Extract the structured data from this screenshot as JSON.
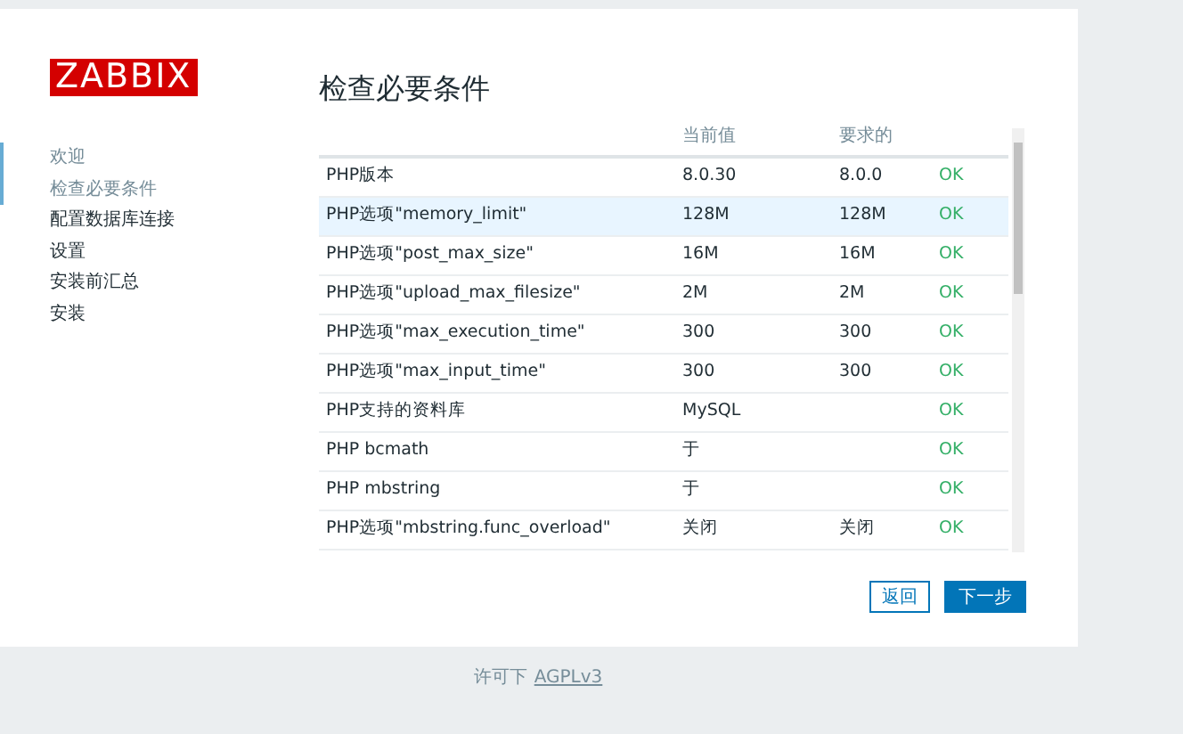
{
  "logo": "ZABBIX",
  "steps": [
    {
      "label": "欢迎",
      "completed": true
    },
    {
      "label": "检查必要条件",
      "completed": true
    },
    {
      "label": "配置数据库连接",
      "completed": false
    },
    {
      "label": "设置",
      "completed": false
    },
    {
      "label": "安装前汇总",
      "completed": false
    },
    {
      "label": "安装",
      "completed": false
    }
  ],
  "title": "检查必要条件",
  "table": {
    "columns": [
      "当前值",
      "要求的"
    ],
    "rows": [
      {
        "name": "PHP版本",
        "current": "8.0.30",
        "required": "8.0.0",
        "status": "OK",
        "highlighted": false
      },
      {
        "name": "PHP选项\"memory_limit\"",
        "current": "128M",
        "required": "128M",
        "status": "OK",
        "highlighted": true
      },
      {
        "name": "PHP选项\"post_max_size\"",
        "current": "16M",
        "required": "16M",
        "status": "OK",
        "highlighted": false
      },
      {
        "name": "PHP选项\"upload_max_filesize\"",
        "current": "2M",
        "required": "2M",
        "status": "OK",
        "highlighted": false
      },
      {
        "name": "PHP选项\"max_execution_time\"",
        "current": "300",
        "required": "300",
        "status": "OK",
        "highlighted": false
      },
      {
        "name": "PHP选项\"max_input_time\"",
        "current": "300",
        "required": "300",
        "status": "OK",
        "highlighted": false
      },
      {
        "name": "PHP支持的资料库",
        "current": "MySQL",
        "status": "OK",
        "highlighted": false
      },
      {
        "name": "PHP bcmath",
        "current": "于",
        "status": "OK",
        "highlighted": false
      },
      {
        "name": "PHP mbstring",
        "current": "于",
        "status": "OK",
        "highlighted": false
      },
      {
        "name": "PHP选项\"mbstring.func_overload\"",
        "current": "关闭",
        "required": "关闭",
        "status": "OK",
        "highlighted": false
      }
    ]
  },
  "buttons": {
    "back": "返回",
    "next": "下一步"
  },
  "footer": {
    "text": "许可下",
    "link": "AGPLv3"
  }
}
